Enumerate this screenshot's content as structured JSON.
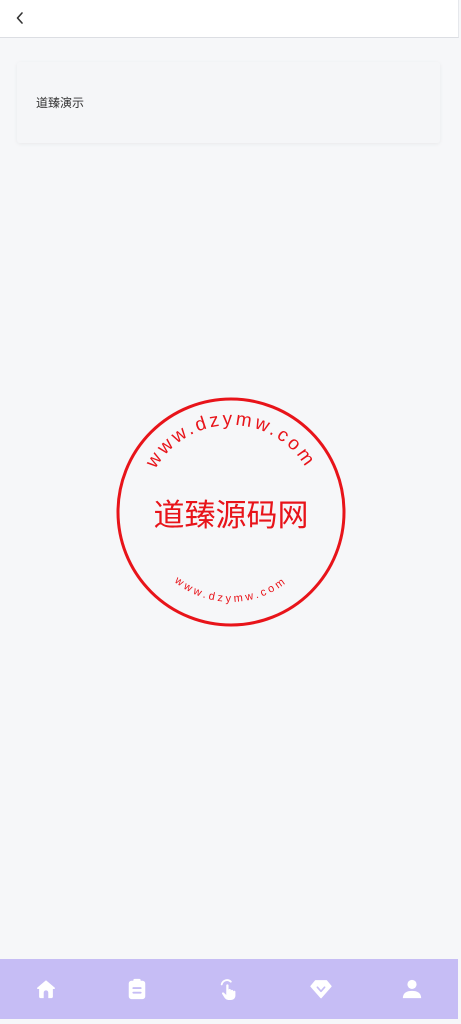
{
  "header": {
    "back_icon": "chevron-left-icon"
  },
  "card": {
    "title": "道臻演示"
  },
  "seal": {
    "color": "#e8141a",
    "center_text": "道臻源码网",
    "outer_ring_text": "www.dzymw.com",
    "inner_ring_text": "www.dzymw.com"
  },
  "bottom_nav": {
    "background": "#c6bdf5",
    "icon_color": "#ffffff",
    "items": [
      {
        "icon": "home-icon"
      },
      {
        "icon": "clipboard-icon"
      },
      {
        "icon": "hand-pointer-icon"
      },
      {
        "icon": "diamond-icon"
      },
      {
        "icon": "user-icon"
      }
    ]
  }
}
